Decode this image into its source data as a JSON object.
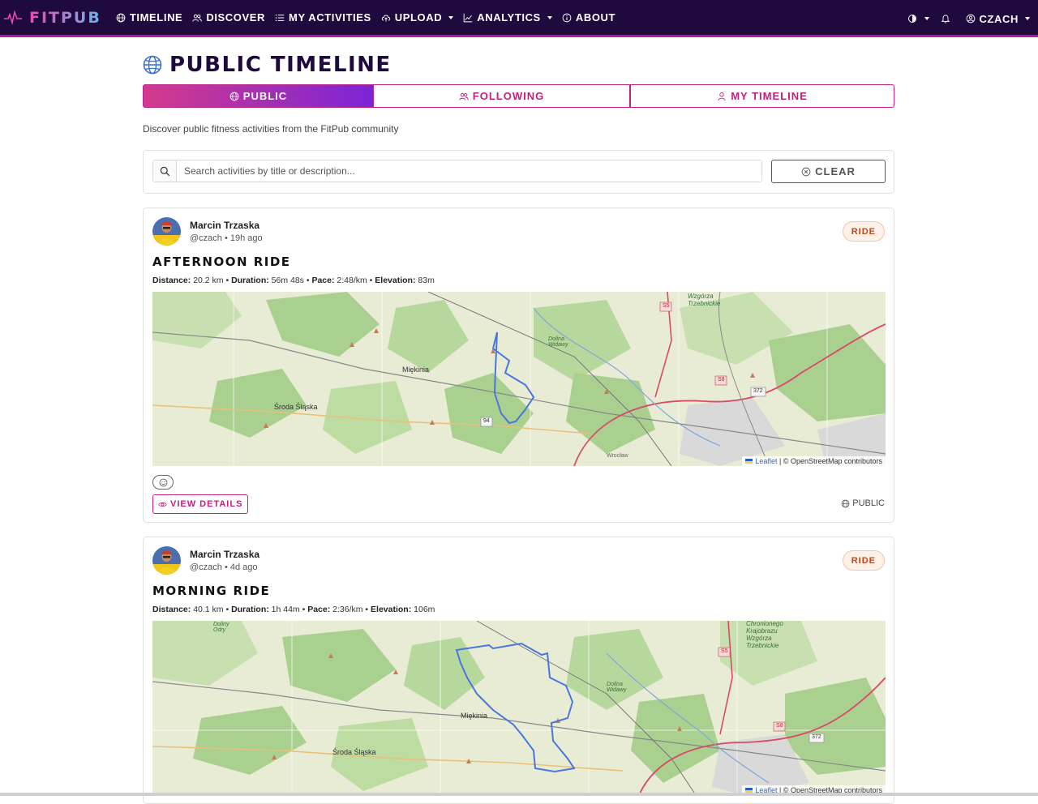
{
  "nav": {
    "brand": "FITPUB",
    "items": [
      {
        "label": "TIMELINE",
        "icon": "globe-icon"
      },
      {
        "label": "DISCOVER",
        "icon": "users-icon"
      },
      {
        "label": "MY ACTIVITIES",
        "icon": "list-icon"
      },
      {
        "label": "UPLOAD",
        "icon": "cloud-upload-icon",
        "dropdown": true
      },
      {
        "label": "ANALYTICS",
        "icon": "chart-line-icon",
        "dropdown": true
      },
      {
        "label": "ABOUT",
        "icon": "info-circle-icon"
      }
    ],
    "right": {
      "theme_icon": "contrast-icon",
      "bell_icon": "bell-icon",
      "user_label": "CZACH"
    }
  },
  "page": {
    "title": "PUBLIC TIMELINE",
    "subtitle": "Discover public fitness activities from the FitPub community",
    "tabs": [
      {
        "label": "PUBLIC",
        "active": true
      },
      {
        "label": "FOLLOWING",
        "active": false
      },
      {
        "label": "MY TIMELINE",
        "active": false
      }
    ]
  },
  "search": {
    "placeholder": "Search activities by title or description...",
    "value": "",
    "clear_label": "CLEAR"
  },
  "activities": [
    {
      "user_name": "Marcin Trzaska",
      "user_meta": "@czach • 19h ago",
      "type": "RIDE",
      "title": "AFTERNOON RIDE",
      "stats": [
        {
          "label": "Distance:",
          "value": "20.2 km"
        },
        {
          "label": "Duration:",
          "value": "56m 48s"
        },
        {
          "label": "Pace:",
          "value": "2:48/km"
        },
        {
          "label": "Elevation:",
          "value": "83m"
        }
      ],
      "map_labels": [
        "Miękinia",
        "Środa Śląska",
        "Dolina Widawy",
        "Wzgórza Trzebnickie",
        "Wrocław"
      ],
      "road_labels": [
        "S5",
        "S8",
        "372",
        "94"
      ],
      "attribution_link": "Leaflet",
      "attribution_text": "| © OpenStreetMap contributors",
      "view_label": "VIEW DETAILS",
      "visibility": "PUBLIC"
    },
    {
      "user_name": "Marcin Trzaska",
      "user_meta": "@czach • 4d ago",
      "type": "RIDE",
      "title": "MORNING RIDE",
      "stats": [
        {
          "label": "Distance:",
          "value": "40.1 km"
        },
        {
          "label": "Duration:",
          "value": "1h 44m"
        },
        {
          "label": "Pace:",
          "value": "2:36/km"
        },
        {
          "label": "Elevation:",
          "value": "106m"
        }
      ],
      "map_labels": [
        "Miękinia",
        "Środa Śląska",
        "Dolina Widawy",
        "Chronionego Krajobrazu Wzgórza Trzebnickie",
        "Doliny Odry"
      ],
      "road_labels": [
        "S5",
        "S8",
        "372"
      ],
      "attribution_link": "Leaflet",
      "attribution_text": "| © OpenStreetMap contributors",
      "view_label": "VIEW DETAILS",
      "visibility": "PUBLIC"
    }
  ]
}
